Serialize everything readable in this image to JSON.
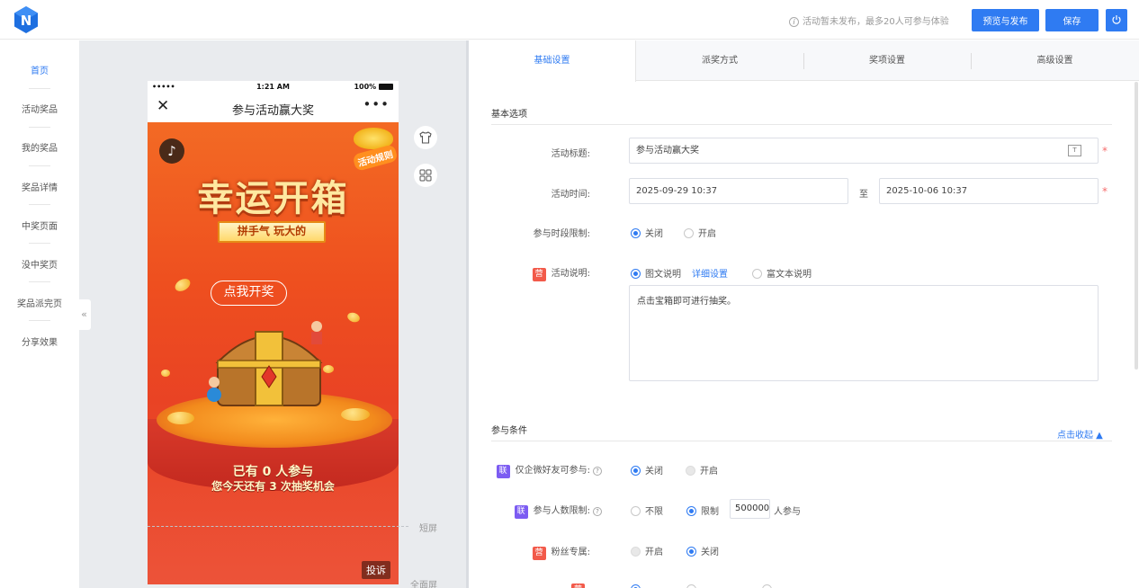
{
  "topbar": {
    "notice": "活动暂未发布，最多20人可参与体验",
    "preview_publish_label": "预览与发布",
    "save_label": "保存"
  },
  "leftnav": {
    "items": [
      "首页",
      "活动奖品",
      "我的奖品",
      "奖品详情",
      "中奖页面",
      "没中奖页",
      "奖品派完页",
      "分享效果"
    ],
    "collapse_glyph": "«"
  },
  "phone": {
    "status_dots": "•••••",
    "status_time": "1:21 AM",
    "status_battery": "100%",
    "nav_title": "参与活动赢大奖",
    "close_glyph": "✕",
    "more_glyph": "•••",
    "rule_badge": "活动规则",
    "big_title": "幸运开箱",
    "sub_banner": "拼手气 玩大的",
    "bubble": "点我开奖",
    "count_line": "已有 0 人参与",
    "chance_line": "您今天还有 3 次抽奖机会",
    "complain_label": "投诉"
  },
  "guides": {
    "short_screen": "短屏",
    "full_screen": "全面屏"
  },
  "tabs": [
    "基础设置",
    "派奖方式",
    "奖项设置",
    "高级设置"
  ],
  "basic": {
    "section_title": "基本选项",
    "title_label": "活动标题:",
    "title_value": "参与活动赢大奖",
    "time_label": "活动时间:",
    "time_start": "2025-09-29 10:37",
    "time_to": "至",
    "time_end": "2025-10-06 10:37",
    "period_label": "参与时段限制:",
    "period_off": "关闭",
    "period_on": "开启",
    "desc_tag": "营",
    "desc_label": "活动说明:",
    "desc_rich": "图文说明",
    "desc_detail_link": "详细设置",
    "desc_richtext": "富文本说明",
    "desc_content": "点击宝箱即可进行抽奖。"
  },
  "conditions": {
    "section_title": "参与条件",
    "collapse_link": "点击收起 ▲",
    "wecom_tag": "联",
    "wecom_label": "仅企微好友可参与:",
    "wecom_off": "关闭",
    "wecom_on": "开启",
    "limit_tag": "联",
    "limit_label": "参与人数限制:",
    "limit_none": "不限",
    "limit_on": "限制",
    "limit_value": "500000",
    "limit_suffix": "人参与",
    "fans_tag": "营",
    "fans_label": "粉丝专属:",
    "fans_on": "开启",
    "fans_off": "关闭"
  },
  "colors": {
    "primary": "#2f7bf2",
    "required": "#f56c6c",
    "tag_red": "#f25a4a",
    "tag_purple": "#7c5cf2"
  }
}
